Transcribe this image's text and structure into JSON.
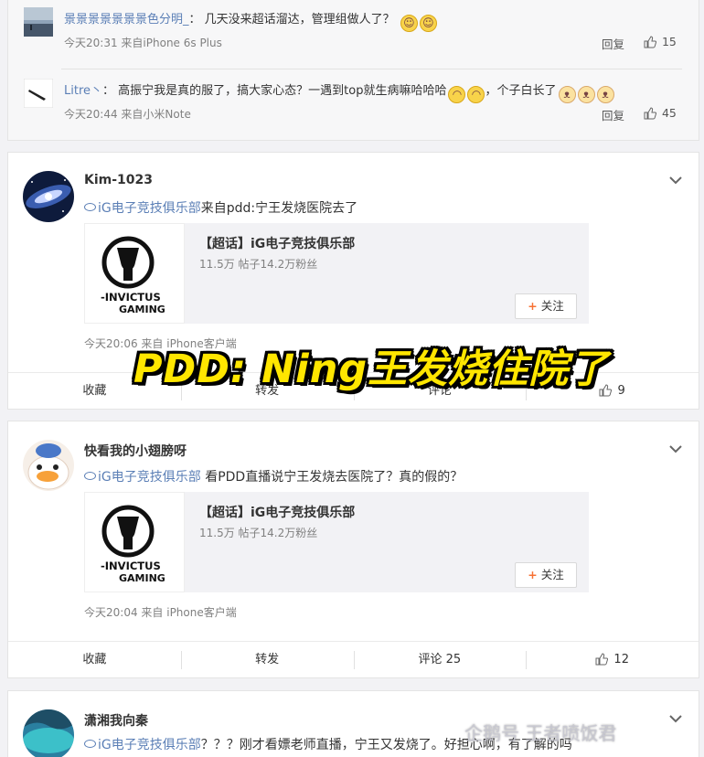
{
  "comments": [
    {
      "name": "景景景景景景景色分明_",
      "sep": "：",
      "text": "几天没来超话溜达，管理组做人了？",
      "emojis": [
        "😂",
        "😂"
      ],
      "text_after": "",
      "time": "今天20:31",
      "source": "来自iPhone 6s Plus",
      "reply": "回复",
      "likes": "15"
    },
    {
      "name": "Litre丶",
      "sep": "：",
      "text": "高振宁我是真的服了，搞大家心态？一遇到top就生病嘛哈哈哈",
      "emojis": [
        "😏",
        "😏"
      ],
      "text_after": "，个子白长了",
      "emojis_after": [
        "🐱",
        "🐱",
        "🐱"
      ],
      "time": "今天20:44",
      "source": "来自小米Note",
      "reply": "回复",
      "likes": "45"
    }
  ],
  "posts": [
    {
      "name": "Kim-1023",
      "link": "iG电子竞技俱乐部",
      "text": "来自pdd:宁王发烧医院去了",
      "share_title": "【超话】iG电子竞技俱乐部",
      "share_stats": "11.5万 帖子14.2万粉丝",
      "follow": "关注",
      "logo_text": "INVICTUS GAMING",
      "time": "今天20:06",
      "source": "来自 iPhone客户端",
      "actions": [
        "收藏",
        "转发",
        "评论",
        "9"
      ]
    },
    {
      "name": "快看我的小翅膀呀",
      "link": "iG电子竞技俱乐部",
      "text": " 看PDD直播说宁王发烧去医院了？真的假的？",
      "share_title": "【超话】iG电子竞技俱乐部",
      "share_stats": "11.5万 帖子14.2万粉丝",
      "follow": "关注",
      "logo_text": "INVICTUS GAMING",
      "time": "今天20:04",
      "source": "来自 iPhone客户端",
      "actions": [
        "收藏",
        "转发",
        "评论 25",
        "12"
      ]
    },
    {
      "name": "潇湘我向秦",
      "link": "iG电子竞技俱乐部",
      "text": "？？？刚才看嫖老师直播，宁王又发烧了。好担心啊，有了解的吗"
    }
  ],
  "overlay": "PDD: Ning王发烧住院了",
  "watermark": "企鹅号 王者喷饭君",
  "colors": {
    "link": "#5b7fb6",
    "overlay_fill": "#ffe600",
    "follow_plus": "#f77234"
  }
}
